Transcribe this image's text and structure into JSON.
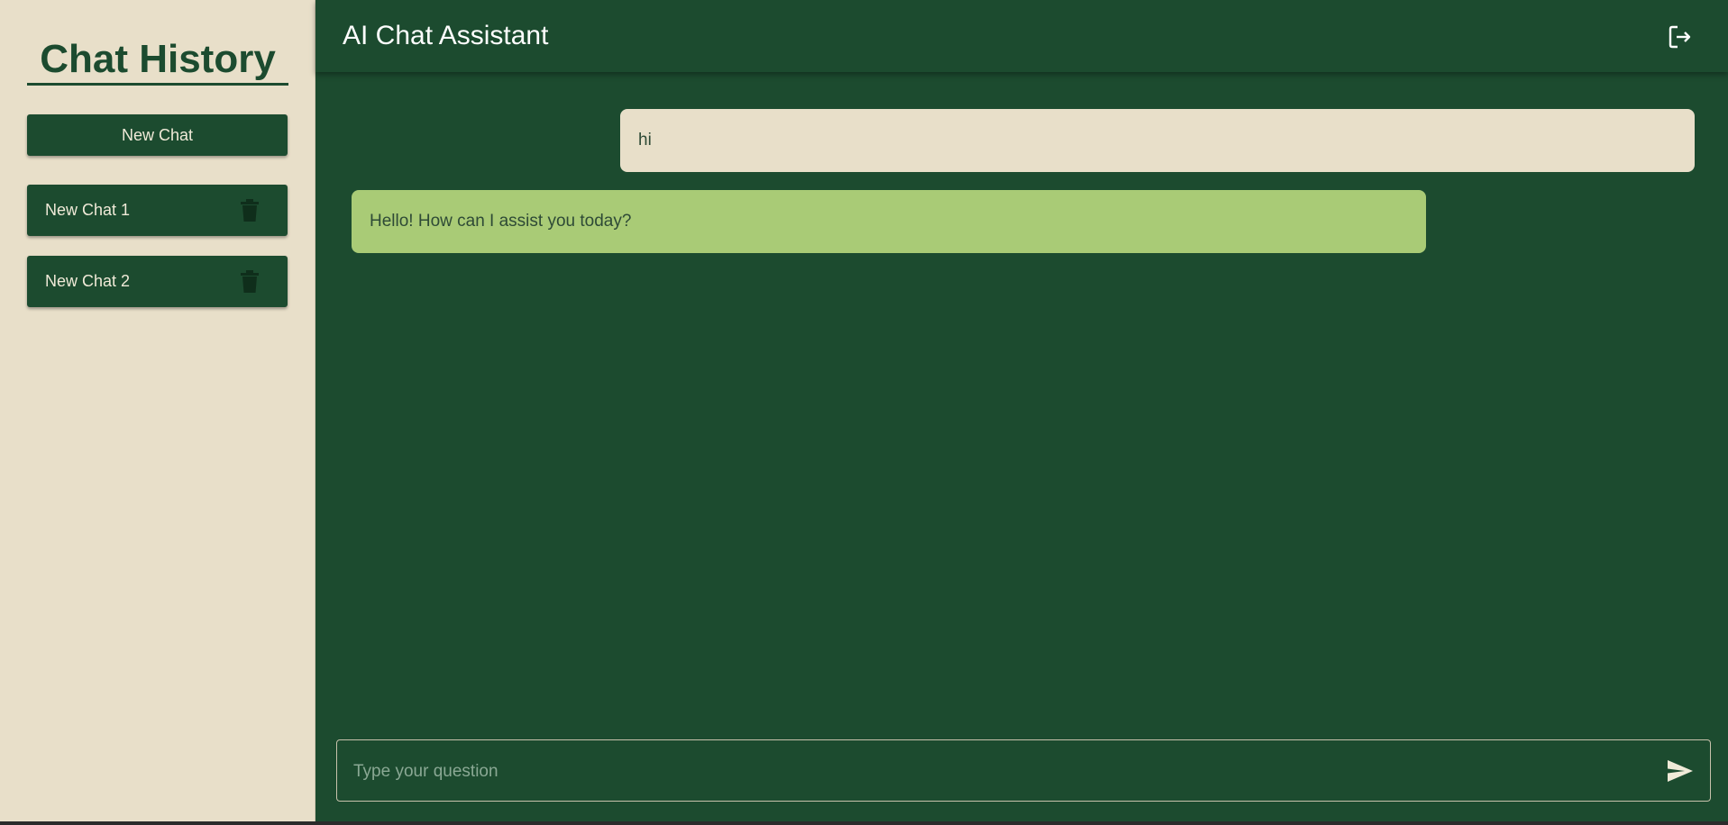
{
  "sidebar": {
    "title": "Chat History",
    "new_chat_label": "New Chat",
    "chats": [
      {
        "label": "New Chat 1"
      },
      {
        "label": "New Chat 2"
      }
    ]
  },
  "header": {
    "title": "AI Chat Assistant"
  },
  "messages": [
    {
      "role": "user",
      "text": "hi"
    },
    {
      "role": "assistant",
      "text": "Hello! How can I assist you today?"
    }
  ],
  "composer": {
    "placeholder": "Type your question",
    "value": ""
  },
  "colors": {
    "primary": "#1c4b2f",
    "sidebar_bg": "#e8dfc9",
    "user_bubble": "#e8dfc9",
    "assistant_bubble": "#a9cb76"
  },
  "icons": {
    "delete": "trash-icon",
    "logout": "logout-icon",
    "send": "send-icon"
  }
}
